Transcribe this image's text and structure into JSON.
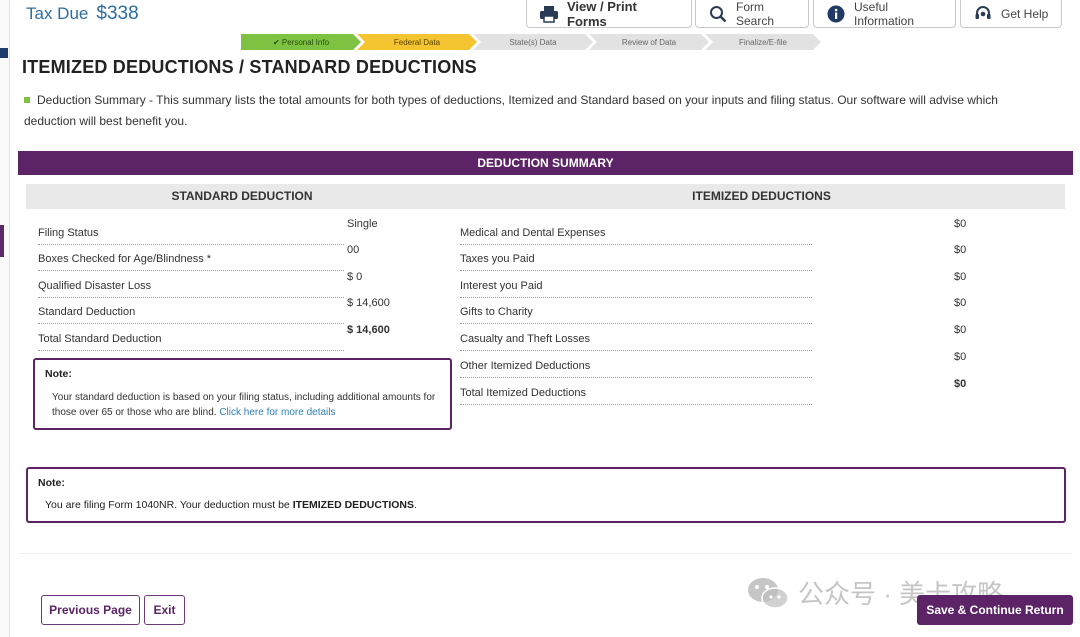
{
  "header": {
    "tax_due_label": "Tax Due",
    "tax_due_amount": "$338",
    "view_print_label": "View / Print Forms",
    "form_search_label": "Form Search",
    "useful_info_label": "Useful Information",
    "get_help_label": "Get Help"
  },
  "progress": {
    "steps": [
      {
        "label": "✔ Personal Info"
      },
      {
        "label": "Federal Data"
      },
      {
        "label": "State(s) Data"
      },
      {
        "label": "Review of Data"
      },
      {
        "label": "Finalize/E-file"
      }
    ]
  },
  "page": {
    "title": "ITEMIZED DEDUCTIONS / STANDARD DEDUCTIONS",
    "intro": "Deduction Summary - This summary lists the total amounts for both types of deductions, Itemized and Standard based on your inputs and filing status. Our software will advise which deduction will best benefit you."
  },
  "summary": {
    "header": "DEDUCTION SUMMARY",
    "standard": {
      "heading": "STANDARD DEDUCTION",
      "rows": [
        {
          "label": "Filing Status",
          "value": "Single"
        },
        {
          "label": "Boxes Checked for Age/Blindness *",
          "value": "00"
        },
        {
          "label": "Qualified Disaster Loss",
          "value": "$ 0"
        },
        {
          "label": "Standard Deduction",
          "value": "$ 14,600"
        },
        {
          "label": "Total Standard Deduction",
          "value": "$ 14,600"
        }
      ]
    },
    "itemized": {
      "heading": "ITEMIZED DEDUCTIONS",
      "rows": [
        {
          "label": "Medical and Dental Expenses",
          "value": "$0"
        },
        {
          "label": "Taxes you Paid",
          "value": "$0"
        },
        {
          "label": "Interest you Paid",
          "value": "$0"
        },
        {
          "label": "Gifts to Charity",
          "value": "$0"
        },
        {
          "label": "Casualty and Theft Losses",
          "value": "$0"
        },
        {
          "label": "Other Itemized Deductions",
          "value": "$0"
        },
        {
          "label": "Total Itemized Deductions",
          "value": "$0"
        }
      ]
    }
  },
  "note_standard": {
    "title": "Note:",
    "body": "Your standard deduction is based on your filing status, including additional amounts for those over 65 or those who are blind.",
    "link": "Click here for more details"
  },
  "note_filing": {
    "title": "Note:",
    "body_prefix": "You are filing Form 1040NR. Your deduction must be ",
    "body_bold": "ITEMIZED DEDUCTIONS",
    "body_suffix": "."
  },
  "footer": {
    "previous_label": "Previous Page",
    "exit_label": "Exit",
    "save_label": "Save & Continue Return"
  },
  "watermark": {
    "text": "公众号 · 美卡攻略"
  },
  "colors": {
    "brand_purple": "#5c2466",
    "tax_due_blue": "#2d6d9f",
    "step_done": "#7dc241",
    "step_active": "#f4c530"
  }
}
